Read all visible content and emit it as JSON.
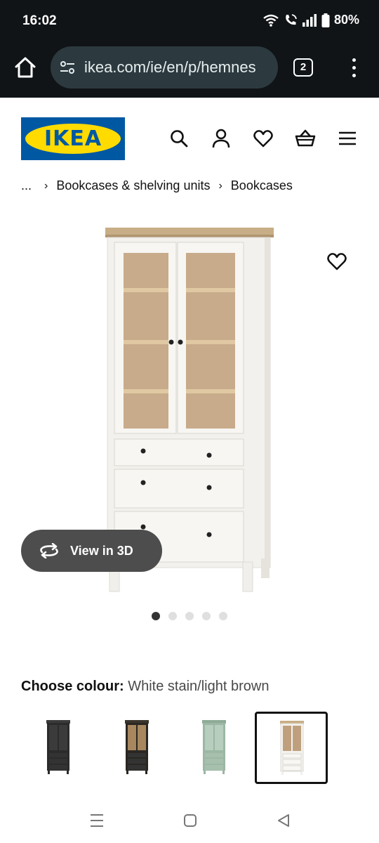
{
  "status_bar": {
    "time": "16:02",
    "battery": "80%"
  },
  "browser": {
    "url": "ikea.com/ie/en/p/hemnes",
    "tab_count": "2"
  },
  "site": {
    "logo_text": "IKEA",
    "brand_colors": {
      "blue": "#0058a3",
      "yellow": "#ffdb00"
    }
  },
  "header_icons": [
    "search-icon",
    "profile-icon",
    "heart-icon",
    "basket-icon",
    "hamburger-menu-icon"
  ],
  "breadcrumb": {
    "ellipsis": "...",
    "items": [
      "Bookcases & shelving units",
      "Bookcases"
    ]
  },
  "product": {
    "view_3d_label": "View in 3D",
    "image_count": 5,
    "active_image_index": 0
  },
  "colour": {
    "label": "Choose colour:",
    "value": "White stain/light brown",
    "options": [
      {
        "name": "black-brown",
        "color": "#2b2b2b",
        "selected": false
      },
      {
        "name": "black-brown/light brown",
        "color": "#2a2722",
        "selected": false
      },
      {
        "name": "green",
        "color": "#9cb7a4",
        "selected": false
      },
      {
        "name": "White stain/light brown",
        "color": "#f4f2ee",
        "selected": true
      }
    ]
  }
}
